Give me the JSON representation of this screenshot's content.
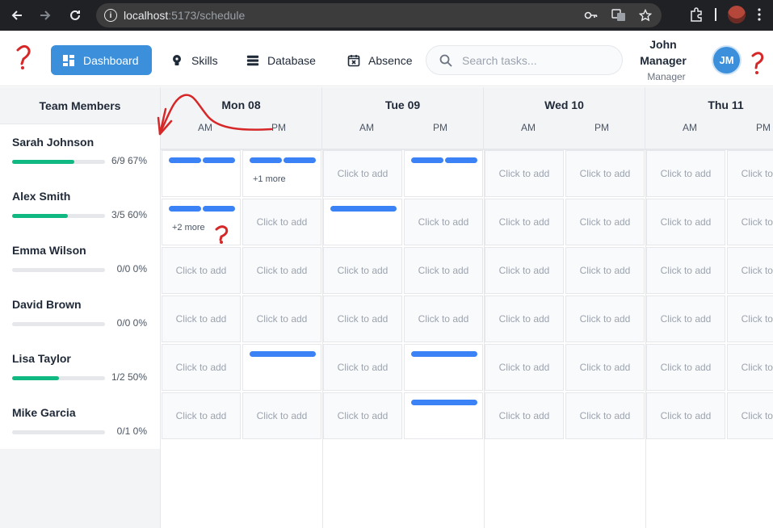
{
  "browser": {
    "host": "localhost",
    "path": ":5173/schedule"
  },
  "header": {
    "tabs": [
      {
        "label": "Dashboard",
        "icon": "grid-icon",
        "active": true
      },
      {
        "label": "Skills",
        "icon": "lightbulb-icon",
        "active": false
      },
      {
        "label": "Database",
        "icon": "database-icon",
        "active": false
      },
      {
        "label": "Absence",
        "icon": "calendar-x-icon",
        "active": false
      }
    ],
    "search_placeholder": "Search tasks...",
    "user": {
      "name_line1": "John",
      "name_line2": "Manager",
      "role": "Manager",
      "initials": "JM"
    }
  },
  "sidebar": {
    "title": "Team Members",
    "members": [
      {
        "name": "Sarah Johnson",
        "stat": "6/9 67%",
        "progress": 0.67
      },
      {
        "name": "Alex Smith",
        "stat": "3/5 60%",
        "progress": 0.6
      },
      {
        "name": "Emma Wilson",
        "stat": "0/0 0%",
        "progress": 0
      },
      {
        "name": "David Brown",
        "stat": "0/0 0%",
        "progress": 0
      },
      {
        "name": "Lisa Taylor",
        "stat": "1/2 50%",
        "progress": 0.5
      },
      {
        "name": "Mike Garcia",
        "stat": "0/1 0%",
        "progress": 0
      }
    ]
  },
  "schedule": {
    "days": [
      {
        "title": "Mon 08",
        "am": "AM",
        "pm": "PM"
      },
      {
        "title": "Tue 09",
        "am": "AM",
        "pm": "PM"
      },
      {
        "title": "Wed 10",
        "am": "AM",
        "pm": "PM"
      },
      {
        "title": "Thu 11",
        "am": "AM",
        "pm": "PM"
      }
    ],
    "empty_label": "Click to add",
    "grid": [
      [
        {
          "tasks": 2,
          "more": ""
        },
        {
          "tasks": 2,
          "more": "+1 more"
        },
        {
          "tasks": 0
        },
        {
          "tasks": 2,
          "more": ""
        },
        {
          "tasks": 0
        },
        {
          "tasks": 0
        },
        {
          "tasks": 0
        },
        {
          "tasks": 0
        }
      ],
      [
        {
          "tasks": 2,
          "more": "+2 more"
        },
        {
          "tasks": 0
        },
        {
          "tasks": 1,
          "more": ""
        },
        {
          "tasks": 0
        },
        {
          "tasks": 0
        },
        {
          "tasks": 0
        },
        {
          "tasks": 0
        },
        {
          "tasks": 0
        }
      ],
      [
        {
          "tasks": 0
        },
        {
          "tasks": 0
        },
        {
          "tasks": 0
        },
        {
          "tasks": 0
        },
        {
          "tasks": 0
        },
        {
          "tasks": 0
        },
        {
          "tasks": 0
        },
        {
          "tasks": 0
        }
      ],
      [
        {
          "tasks": 0
        },
        {
          "tasks": 0
        },
        {
          "tasks": 0
        },
        {
          "tasks": 0
        },
        {
          "tasks": 0
        },
        {
          "tasks": 0
        },
        {
          "tasks": 0
        },
        {
          "tasks": 0
        }
      ],
      [
        {
          "tasks": 0
        },
        {
          "tasks": 1,
          "more": ""
        },
        {
          "tasks": 0
        },
        {
          "tasks": 1,
          "more": ""
        },
        {
          "tasks": 0
        },
        {
          "tasks": 0
        },
        {
          "tasks": 0
        },
        {
          "tasks": 0
        }
      ],
      [
        {
          "tasks": 0
        },
        {
          "tasks": 0
        },
        {
          "tasks": 0
        },
        {
          "tasks": 1,
          "more": ""
        },
        {
          "tasks": 0
        },
        {
          "tasks": 0
        },
        {
          "tasks": 0
        },
        {
          "tasks": 0
        }
      ]
    ]
  },
  "annotations": {
    "marks": [
      "?",
      "?",
      "?"
    ]
  },
  "colors": {
    "accent": "#3b8fdb",
    "task": "#3b82f6",
    "progress": "#10b981",
    "annotation": "#d62828"
  }
}
